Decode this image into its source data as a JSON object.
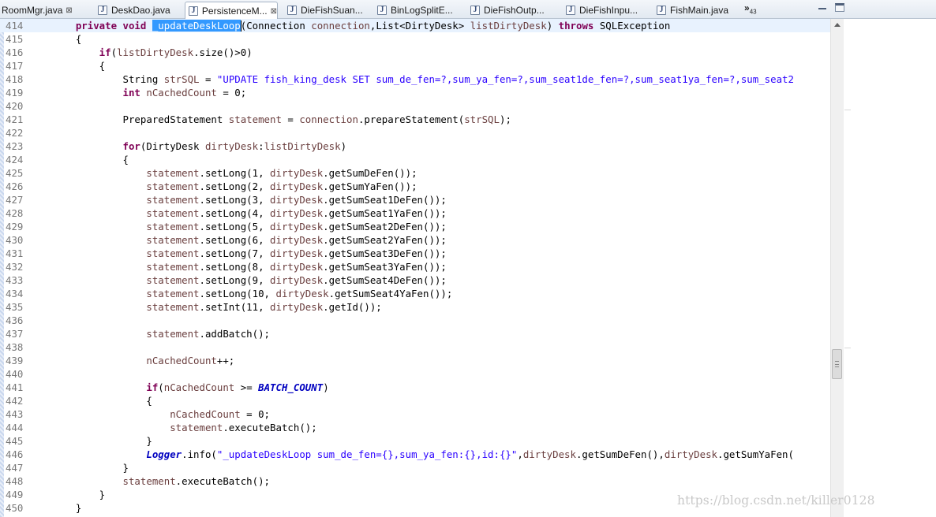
{
  "tabs": [
    {
      "label": "RoomMgr.java",
      "active": false,
      "closable": true
    },
    {
      "label": "DeskDao.java",
      "active": false,
      "closable": false
    },
    {
      "label": "PersistenceM...",
      "active": true,
      "closable": true
    },
    {
      "label": "DieFishSuan...",
      "active": false,
      "closable": false
    },
    {
      "label": "BinLogSplitE...",
      "active": false,
      "closable": false
    },
    {
      "label": "DieFishOutp...",
      "active": false,
      "closable": false
    },
    {
      "label": "DieFishInpu...",
      "active": false,
      "closable": false
    },
    {
      "label": "FishMain.java",
      "active": false,
      "closable": false
    }
  ],
  "tab_icon": "java-file-icon",
  "tab_icon_glyph": "J",
  "close_glyph": "⊠",
  "overflow": {
    "glyph": "»",
    "count": "43"
  },
  "lines": [
    {
      "n": "414",
      "tokens": [
        [
          "kw",
          "    private void "
        ],
        [
          "sel",
          "_updateDeskLoop"
        ],
        [
          "caret",
          ""
        ],
        [
          "plain",
          "(Connection "
        ],
        [
          "var",
          "connection"
        ],
        [
          "plain",
          ",List<DirtyDesk> "
        ],
        [
          "var",
          "listDirtyDesk"
        ],
        [
          "plain",
          ") "
        ],
        [
          "kw",
          "throws"
        ],
        [
          "plain",
          " SQLException"
        ]
      ]
    },
    {
      "n": "415",
      "tokens": [
        [
          "plain",
          "    {"
        ]
      ]
    },
    {
      "n": "416",
      "tokens": [
        [
          "kw",
          "        if"
        ],
        [
          "plain",
          "("
        ],
        [
          "var",
          "listDirtyDesk"
        ],
        [
          "plain",
          ".size()>0)"
        ]
      ]
    },
    {
      "n": "417",
      "tokens": [
        [
          "plain",
          "        {"
        ]
      ]
    },
    {
      "n": "418",
      "tokens": [
        [
          "plain",
          "            String "
        ],
        [
          "var",
          "strSQL"
        ],
        [
          "plain",
          " = "
        ],
        [
          "str",
          "\"UPDATE fish_king_desk SET sum_de_fen=?,sum_ya_fen=?,sum_seat1de_fen=?,sum_seat1ya_fen=?,sum_seat2"
        ]
      ]
    },
    {
      "n": "419",
      "tokens": [
        [
          "kw",
          "            int"
        ],
        [
          "plain",
          " "
        ],
        [
          "var",
          "nCachedCount"
        ],
        [
          "plain",
          " = 0;"
        ]
      ]
    },
    {
      "n": "420",
      "tokens": [
        [
          "plain",
          ""
        ]
      ]
    },
    {
      "n": "421",
      "tokens": [
        [
          "plain",
          "            PreparedStatement "
        ],
        [
          "var",
          "statement"
        ],
        [
          "plain",
          " = "
        ],
        [
          "var",
          "connection"
        ],
        [
          "plain",
          ".prepareStatement("
        ],
        [
          "var",
          "strSQL"
        ],
        [
          "plain",
          ");"
        ]
      ]
    },
    {
      "n": "422",
      "tokens": [
        [
          "plain",
          ""
        ]
      ]
    },
    {
      "n": "423",
      "tokens": [
        [
          "kw",
          "            for"
        ],
        [
          "plain",
          "(DirtyDesk "
        ],
        [
          "var",
          "dirtyDesk"
        ],
        [
          "plain",
          ":"
        ],
        [
          "var",
          "listDirtyDesk"
        ],
        [
          "plain",
          ")"
        ]
      ]
    },
    {
      "n": "424",
      "tokens": [
        [
          "plain",
          "            {"
        ]
      ]
    },
    {
      "n": "425",
      "tokens": [
        [
          "var",
          "                statement"
        ],
        [
          "plain",
          ".setLong(1, "
        ],
        [
          "var",
          "dirtyDesk"
        ],
        [
          "plain",
          ".getSumDeFen());"
        ]
      ]
    },
    {
      "n": "426",
      "tokens": [
        [
          "var",
          "                statement"
        ],
        [
          "plain",
          ".setLong(2, "
        ],
        [
          "var",
          "dirtyDesk"
        ],
        [
          "plain",
          ".getSumYaFen());"
        ]
      ]
    },
    {
      "n": "427",
      "tokens": [
        [
          "var",
          "                statement"
        ],
        [
          "plain",
          ".setLong(3, "
        ],
        [
          "var",
          "dirtyDesk"
        ],
        [
          "plain",
          ".getSumSeat1DeFen());"
        ]
      ]
    },
    {
      "n": "428",
      "tokens": [
        [
          "var",
          "                statement"
        ],
        [
          "plain",
          ".setLong(4, "
        ],
        [
          "var",
          "dirtyDesk"
        ],
        [
          "plain",
          ".getSumSeat1YaFen());"
        ]
      ]
    },
    {
      "n": "429",
      "tokens": [
        [
          "var",
          "                statement"
        ],
        [
          "plain",
          ".setLong(5, "
        ],
        [
          "var",
          "dirtyDesk"
        ],
        [
          "plain",
          ".getSumSeat2DeFen());"
        ]
      ]
    },
    {
      "n": "430",
      "tokens": [
        [
          "var",
          "                statement"
        ],
        [
          "plain",
          ".setLong(6, "
        ],
        [
          "var",
          "dirtyDesk"
        ],
        [
          "plain",
          ".getSumSeat2YaFen());"
        ]
      ]
    },
    {
      "n": "431",
      "tokens": [
        [
          "var",
          "                statement"
        ],
        [
          "plain",
          ".setLong(7, "
        ],
        [
          "var",
          "dirtyDesk"
        ],
        [
          "plain",
          ".getSumSeat3DeFen());"
        ]
      ]
    },
    {
      "n": "432",
      "tokens": [
        [
          "var",
          "                statement"
        ],
        [
          "plain",
          ".setLong(8, "
        ],
        [
          "var",
          "dirtyDesk"
        ],
        [
          "plain",
          ".getSumSeat3YaFen());"
        ]
      ]
    },
    {
      "n": "433",
      "tokens": [
        [
          "var",
          "                statement"
        ],
        [
          "plain",
          ".setLong(9, "
        ],
        [
          "var",
          "dirtyDesk"
        ],
        [
          "plain",
          ".getSumSeat4DeFen());"
        ]
      ]
    },
    {
      "n": "434",
      "tokens": [
        [
          "var",
          "                statement"
        ],
        [
          "plain",
          ".setLong(10, "
        ],
        [
          "var",
          "dirtyDesk"
        ],
        [
          "plain",
          ".getSumSeat4YaFen());"
        ]
      ]
    },
    {
      "n": "435",
      "tokens": [
        [
          "var",
          "                statement"
        ],
        [
          "plain",
          ".setInt(11, "
        ],
        [
          "var",
          "dirtyDesk"
        ],
        [
          "plain",
          ".getId());"
        ]
      ]
    },
    {
      "n": "436",
      "tokens": [
        [
          "plain",
          ""
        ]
      ]
    },
    {
      "n": "437",
      "tokens": [
        [
          "var",
          "                statement"
        ],
        [
          "plain",
          ".addBatch();"
        ]
      ]
    },
    {
      "n": "438",
      "tokens": [
        [
          "plain",
          ""
        ]
      ]
    },
    {
      "n": "439",
      "tokens": [
        [
          "var",
          "                nCachedCount"
        ],
        [
          "plain",
          "++;"
        ]
      ]
    },
    {
      "n": "440",
      "tokens": [
        [
          "plain",
          ""
        ]
      ]
    },
    {
      "n": "441",
      "tokens": [
        [
          "kw",
          "                if"
        ],
        [
          "plain",
          "("
        ],
        [
          "var",
          "nCachedCount"
        ],
        [
          "plain",
          " >= "
        ],
        [
          "fld",
          "BATCH_COUNT"
        ],
        [
          "plain",
          ")"
        ]
      ]
    },
    {
      "n": "442",
      "tokens": [
        [
          "plain",
          "                {"
        ]
      ]
    },
    {
      "n": "443",
      "tokens": [
        [
          "var",
          "                    nCachedCount"
        ],
        [
          "plain",
          " = 0;"
        ]
      ]
    },
    {
      "n": "444",
      "tokens": [
        [
          "var",
          "                    statement"
        ],
        [
          "plain",
          ".executeBatch();"
        ]
      ]
    },
    {
      "n": "445",
      "tokens": [
        [
          "plain",
          "                }"
        ]
      ]
    },
    {
      "n": "446",
      "tokens": [
        [
          "sfld",
          "                Logger"
        ],
        [
          "plain",
          ".info("
        ],
        [
          "str",
          "\"_updateDeskLoop sum_de_fen={},sum_ya_fen:{},id:{}\""
        ],
        [
          "plain",
          ","
        ],
        [
          "var",
          "dirtyDesk"
        ],
        [
          "plain",
          ".getSumDeFen(),"
        ],
        [
          "var",
          "dirtyDesk"
        ],
        [
          "plain",
          ".getSumYaFen("
        ]
      ]
    },
    {
      "n": "447",
      "tokens": [
        [
          "plain",
          "            }"
        ]
      ]
    },
    {
      "n": "448",
      "tokens": [
        [
          "var",
          "            statement"
        ],
        [
          "plain",
          ".executeBatch();"
        ]
      ]
    },
    {
      "n": "449",
      "tokens": [
        [
          "plain",
          "        }"
        ]
      ]
    },
    {
      "n": "450",
      "tokens": [
        [
          "plain",
          "    }"
        ]
      ]
    }
  ],
  "current_line": "414",
  "watermark": "https://blog.csdn.net/killer0128"
}
